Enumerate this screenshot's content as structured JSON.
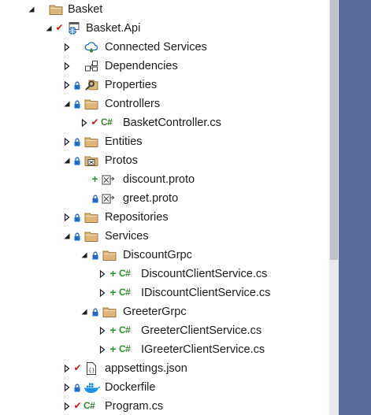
{
  "colors": {
    "folder": "#dcb67a",
    "check_red": "#c51e1e",
    "plus_green": "#388a34",
    "lock_blue": "#1e6ac5",
    "scrollbar_track": "#e8e8ec",
    "scrollbar_thumb": "#c2c3c9",
    "side_panel": "#5d6b99"
  },
  "tree": {
    "rows": [
      {
        "label": "Basket",
        "icon": "folder-icon"
      },
      {
        "label": "Basket.Api",
        "icon": "web-project-icon",
        "status": "checkmark"
      },
      {
        "label": "Connected Services",
        "icon": "connected-services-icon"
      },
      {
        "label": "Dependencies",
        "icon": "dependencies-icon"
      },
      {
        "label": "Properties",
        "icon": "properties-icon",
        "status": "lock"
      },
      {
        "label": "Controllers",
        "icon": "folder-icon",
        "status": "lock"
      },
      {
        "label": "BasketController.cs",
        "icon": "csharp-file-icon",
        "status": "checkmark"
      },
      {
        "label": "Entities",
        "icon": "folder-icon",
        "status": "lock"
      },
      {
        "label": "Protos",
        "icon": "protos-folder-icon",
        "status": "lock"
      },
      {
        "label": "discount.proto",
        "icon": "proto-file-icon",
        "status": "plus"
      },
      {
        "label": "greet.proto",
        "icon": "proto-file-icon",
        "status": "lock"
      },
      {
        "label": "Repositories",
        "icon": "folder-icon",
        "status": "lock"
      },
      {
        "label": "Services",
        "icon": "folder-icon",
        "status": "lock"
      },
      {
        "label": "DiscountGrpc",
        "icon": "folder-icon",
        "status": "lock"
      },
      {
        "label": "DiscountClientService.cs",
        "icon": "csharp-file-icon",
        "status": "plus"
      },
      {
        "label": "IDiscountClientService.cs",
        "icon": "csharp-file-icon",
        "status": "plus"
      },
      {
        "label": "GreeterGrpc",
        "icon": "folder-icon",
        "status": "lock"
      },
      {
        "label": "GreeterClientService.cs",
        "icon": "csharp-file-icon",
        "status": "plus"
      },
      {
        "label": "IGreeterClientService.cs",
        "icon": "csharp-file-icon",
        "status": "plus"
      },
      {
        "label": "appsettings.json",
        "icon": "json-file-icon",
        "status": "checkmark"
      },
      {
        "label": "Dockerfile",
        "icon": "docker-icon",
        "status": "lock"
      },
      {
        "label": "Program.cs",
        "icon": "csharp-file-icon",
        "status": "checkmark"
      }
    ]
  }
}
